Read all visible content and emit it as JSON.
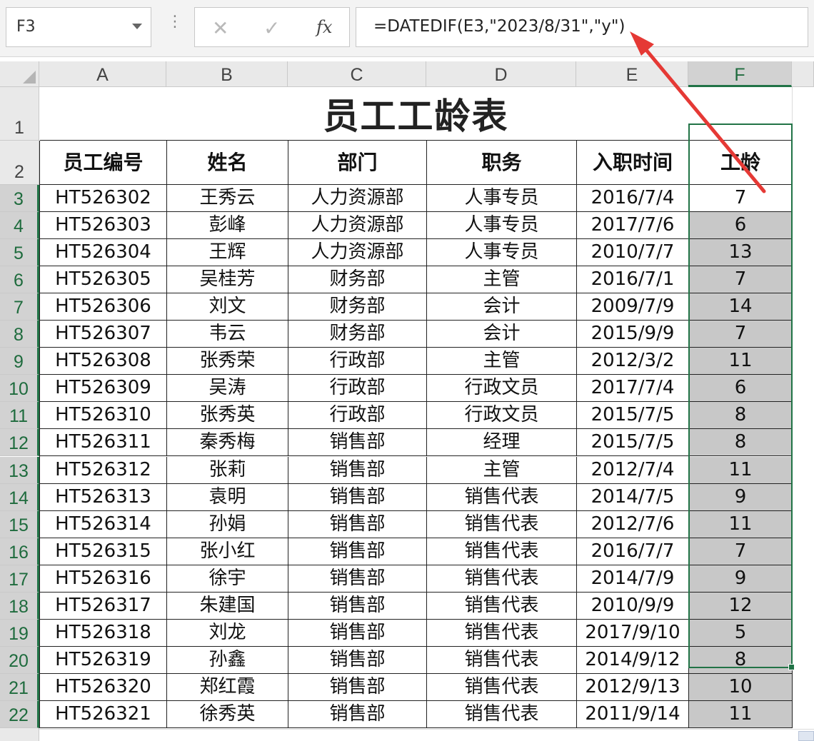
{
  "formula_bar": {
    "name_box": "F3",
    "cancel_icon": "✕",
    "enter_icon": "✓",
    "fx_label": "fx",
    "formula": "=DATEDIF(E3,\"2023/8/31\",\"y\")"
  },
  "columns": [
    "A",
    "B",
    "C",
    "D",
    "E",
    "F"
  ],
  "selected_column": "F",
  "row_numbers": [
    "1",
    "2",
    "3",
    "4",
    "5",
    "6",
    "7",
    "8",
    "9",
    "10",
    "11",
    "12",
    "13",
    "14",
    "15",
    "16",
    "17",
    "18",
    "19",
    "20",
    "21",
    "22"
  ],
  "sheet": {
    "title": "员工工龄表",
    "headers": [
      "员工编号",
      "姓名",
      "部门",
      "职务",
      "入职时间",
      "工龄"
    ],
    "rows": [
      [
        "HT526302",
        "王秀云",
        "人力资源部",
        "人事专员",
        "2016/7/4",
        "7"
      ],
      [
        "HT526303",
        "彭峰",
        "人力资源部",
        "人事专员",
        "2017/7/6",
        "6"
      ],
      [
        "HT526304",
        "王辉",
        "人力资源部",
        "人事专员",
        "2010/7/7",
        "13"
      ],
      [
        "HT526305",
        "吴桂芳",
        "财务部",
        "主管",
        "2016/7/1",
        "7"
      ],
      [
        "HT526306",
        "刘文",
        "财务部",
        "会计",
        "2009/7/9",
        "14"
      ],
      [
        "HT526307",
        "韦云",
        "财务部",
        "会计",
        "2015/9/9",
        "7"
      ],
      [
        "HT526308",
        "张秀荣",
        "行政部",
        "主管",
        "2012/3/2",
        "11"
      ],
      [
        "HT526309",
        "吴涛",
        "行政部",
        "行政文员",
        "2017/7/4",
        "6"
      ],
      [
        "HT526310",
        "张秀英",
        "行政部",
        "行政文员",
        "2015/7/5",
        "8"
      ],
      [
        "HT526311",
        "秦秀梅",
        "销售部",
        "经理",
        "2015/7/5",
        "8"
      ],
      [
        "HT526312",
        "张莉",
        "销售部",
        "主管",
        "2012/7/4",
        "11"
      ],
      [
        "HT526313",
        "袁明",
        "销售部",
        "销售代表",
        "2014/7/5",
        "9"
      ],
      [
        "HT526314",
        "孙娟",
        "销售部",
        "销售代表",
        "2012/7/6",
        "11"
      ],
      [
        "HT526315",
        "张小红",
        "销售部",
        "销售代表",
        "2016/7/7",
        "7"
      ],
      [
        "HT526316",
        "徐宇",
        "销售部",
        "销售代表",
        "2014/7/9",
        "9"
      ],
      [
        "HT526317",
        "朱建国",
        "销售部",
        "销售代表",
        "2010/9/9",
        "12"
      ],
      [
        "HT526318",
        "刘龙",
        "销售部",
        "销售代表",
        "2017/9/10",
        "5"
      ],
      [
        "HT526319",
        "孙鑫",
        "销售部",
        "销售代表",
        "2014/9/12",
        "8"
      ],
      [
        "HT526320",
        "郑红霞",
        "销售部",
        "销售代表",
        "2012/9/13",
        "10"
      ],
      [
        "HT526321",
        "徐秀英",
        "销售部",
        "销售代表",
        "2011/9/14",
        "11"
      ]
    ]
  },
  "colors": {
    "selection": "#217346",
    "annotation_arrow": "#e53935",
    "selected_fill": "#c8c8c8"
  }
}
